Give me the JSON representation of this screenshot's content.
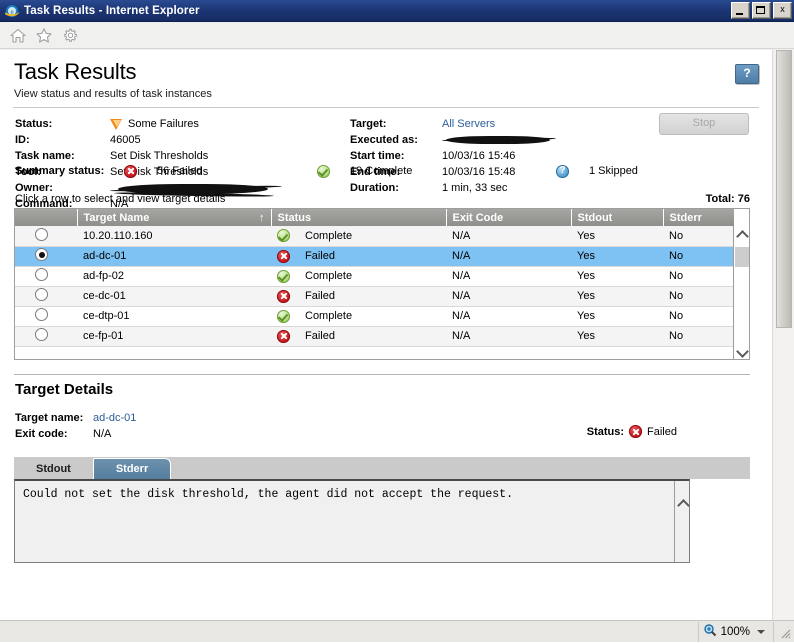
{
  "window": {
    "title": "Task Results - Internet Explorer",
    "icon": "internet-explorer-icon",
    "minimize_label": "",
    "maximize_label": "",
    "close_label": "x"
  },
  "toolbar": {
    "items": [
      {
        "icon": "home-icon",
        "label": "Home"
      },
      {
        "icon": "star-icon",
        "label": "Favorites"
      },
      {
        "icon": "gear-icon",
        "label": "Tools"
      }
    ]
  },
  "header": {
    "title": "Task Results",
    "subtitle": "View status and results of task instances",
    "help_label": "?"
  },
  "actions": {
    "stop_label": "Stop"
  },
  "info": {
    "left": [
      {
        "label": "Status:",
        "value": "Some Failures",
        "icon": "warning-triangle-icon"
      },
      {
        "label": "ID:",
        "value": "46005"
      },
      {
        "label": "Task name:",
        "value": "Set Disk Thresholds"
      },
      {
        "label": "Tool:",
        "value": "Set Disk Thresholds"
      },
      {
        "label": "Owner:",
        "value": "",
        "redacted": true
      },
      {
        "label": "Command:",
        "value": "N/A"
      }
    ],
    "right": [
      {
        "label": "Target:",
        "value": "All Servers",
        "link": true
      },
      {
        "label": "Executed as:",
        "value": "",
        "redacted": true
      },
      {
        "label": "Start time:",
        "value": "10/03/16 15:46"
      },
      {
        "label": "End time:",
        "value": "10/03/16 15:48"
      },
      {
        "label": "Duration:",
        "value": "1 min, 33 sec"
      }
    ]
  },
  "summary": {
    "label": "Summary status:",
    "failed": {
      "count_label": "56 Failed",
      "icon": "error-circle-icon"
    },
    "complete": {
      "count_label": "19 Complete",
      "icon": "success-circle-icon"
    },
    "skipped": {
      "count_label": "1 Skipped",
      "icon": "info-circle-icon"
    }
  },
  "table": {
    "hint": "Click a row to select and view target details",
    "total_label": "Total: 76",
    "sort_column": "Target Name",
    "sort_indicator": "↑",
    "columns": [
      "",
      "Target Name",
      "Status",
      "Exit Code",
      "Stdout",
      "Stderr"
    ],
    "rows": [
      {
        "selected": false,
        "name": "10.20.110.160",
        "status": "Complete",
        "status_icon": "success-circle-icon",
        "exit_code": "N/A",
        "stdout": "Yes",
        "stderr": "No"
      },
      {
        "selected": true,
        "name": "ad-dc-01",
        "status": "Failed",
        "status_icon": "error-circle-icon",
        "exit_code": "N/A",
        "stdout": "Yes",
        "stderr": "No"
      },
      {
        "selected": false,
        "name": "ad-fp-02",
        "status": "Complete",
        "status_icon": "success-circle-icon",
        "exit_code": "N/A",
        "stdout": "Yes",
        "stderr": "No"
      },
      {
        "selected": false,
        "name": "ce-dc-01",
        "status": "Failed",
        "status_icon": "error-circle-icon",
        "exit_code": "N/A",
        "stdout": "Yes",
        "stderr": "No"
      },
      {
        "selected": false,
        "name": "ce-dtp-01",
        "status": "Complete",
        "status_icon": "success-circle-icon",
        "exit_code": "N/A",
        "stdout": "Yes",
        "stderr": "No"
      },
      {
        "selected": false,
        "name": "ce-fp-01",
        "status": "Failed",
        "status_icon": "error-circle-icon",
        "exit_code": "N/A",
        "stdout": "Yes",
        "stderr": "No"
      }
    ]
  },
  "details": {
    "title": "Target Details",
    "target_name_label": "Target name:",
    "target_name_value": "ad-dc-01",
    "exit_code_label": "Exit code:",
    "exit_code_value": "N/A",
    "status_label": "Status:",
    "status_value": "Failed",
    "status_icon": "error-circle-icon",
    "tabs": [
      {
        "label": "Stdout",
        "active": false
      },
      {
        "label": "Stderr",
        "active": true
      }
    ],
    "console_text": "Could not set the disk threshold, the agent did not accept the request."
  },
  "statusbar": {
    "zoom_label": "100%",
    "zoom_icon": "magnifier-plus-icon"
  },
  "colors": {
    "titlebar": "#1c3574",
    "accent_link": "#2c5d9b",
    "row_selected": "#7ec2f3",
    "error": "#c5141a",
    "success": "#7cb03e",
    "info": "#2f7bb5",
    "warning": "#f08a18",
    "tab_active": "#547e9f",
    "header_gray": "#8e8e8a"
  }
}
